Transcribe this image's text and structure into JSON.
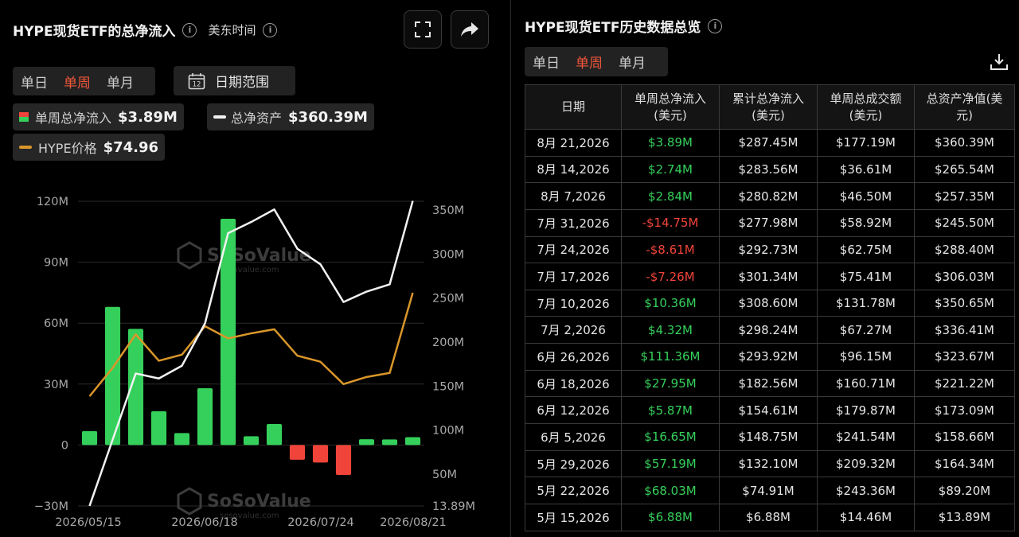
{
  "left": {
    "title": "HYPE现货ETF的总净流入",
    "timezone": "美东时间",
    "tabs": [
      {
        "label": "单日",
        "active": false
      },
      {
        "label": "单周",
        "active": true
      },
      {
        "label": "单月",
        "active": false
      }
    ],
    "date_range_label": "日期范围",
    "calendar_day": "12",
    "icons": {
      "fullscreen": "fullscreen-icon",
      "share": "share-icon",
      "info": "info-icon",
      "calendar": "calendar-icon"
    },
    "legend": [
      {
        "name": "单周总净流入",
        "value": "$3.89M"
      },
      {
        "name": "总净资产",
        "value": "$360.39M"
      },
      {
        "name": "HYPE价格",
        "value": "$74.96"
      }
    ],
    "watermark": {
      "brand": "SoSoValue",
      "site": "sosovalue.com"
    }
  },
  "right": {
    "title": "HYPE现货ETF历史数据总览",
    "tabs": [
      {
        "label": "单日",
        "active": false
      },
      {
        "label": "单周",
        "active": true
      },
      {
        "label": "单月",
        "active": false
      }
    ],
    "export_icon": "download-icon",
    "table": {
      "headers": [
        [
          "日期"
        ],
        [
          "单周总净流入",
          "(美元)"
        ],
        [
          "累计总净流入",
          "(美元)"
        ],
        [
          "单周总成交额",
          "(美元)"
        ],
        [
          "总资产净值(美",
          "元)"
        ]
      ],
      "rows": [
        [
          "8月 21,2026",
          "$3.89M",
          "$287.45M",
          "$177.19M",
          "$360.39M"
        ],
        [
          "8月 14,2026",
          "$2.74M",
          "$283.56M",
          "$36.61M",
          "$265.54M"
        ],
        [
          "8月 7,2026",
          "$2.84M",
          "$280.82M",
          "$46.50M",
          "$257.35M"
        ],
        [
          "7月 31,2026",
          "-$14.75M",
          "$277.98M",
          "$58.92M",
          "$245.50M"
        ],
        [
          "7月 24,2026",
          "-$8.61M",
          "$292.73M",
          "$62.75M",
          "$288.40M"
        ],
        [
          "7月 17,2026",
          "-$7.26M",
          "$301.34M",
          "$75.41M",
          "$306.03M"
        ],
        [
          "7月 10,2026",
          "$10.36M",
          "$308.60M",
          "$131.78M",
          "$350.65M"
        ],
        [
          "7月 2,2026",
          "$4.32M",
          "$298.24M",
          "$67.27M",
          "$336.41M"
        ],
        [
          "6月 26,2026",
          "$111.36M",
          "$293.92M",
          "$96.15M",
          "$323.67M"
        ],
        [
          "6月 18,2026",
          "$27.95M",
          "$182.56M",
          "$160.71M",
          "$221.22M"
        ],
        [
          "6月 12,2026",
          "$5.87M",
          "$154.61M",
          "$179.87M",
          "$173.09M"
        ],
        [
          "6月 5,2026",
          "$16.65M",
          "$148.75M",
          "$241.54M",
          "$158.66M"
        ],
        [
          "5月 29,2026",
          "$57.19M",
          "$132.10M",
          "$209.32M",
          "$164.34M"
        ],
        [
          "5月 22,2026",
          "$68.03M",
          "$74.91M",
          "$243.36M",
          "$89.20M"
        ],
        [
          "5月 15,2026",
          "$6.88M",
          "$6.88M",
          "$14.46M",
          "$13.89M"
        ]
      ]
    }
  },
  "colors": {
    "positive": "#35d05b",
    "negative": "#f0443a",
    "active_tab": "#f0553b",
    "net_assets_line": "#f2f2f2",
    "price_line": "#d9962a",
    "background": "#000000"
  },
  "chart_data": {
    "type": "bar",
    "categories": [
      "2026/05/15",
      "2026/05/22",
      "2026/05/29",
      "2026/06/05",
      "2026/06/12",
      "2026/06/18",
      "2026/06/26",
      "2026/07/02",
      "2026/07/10",
      "2026/07/17",
      "2026/07/24",
      "2026/07/31",
      "2026/08/07",
      "2026/08/14",
      "2026/08/21"
    ],
    "x_tick_labels": [
      "2026/05/15",
      "2026/06/18",
      "2026/07/24",
      "2026/08/21"
    ],
    "series": [
      {
        "name": "单周总净流入",
        "type": "bar",
        "axis": "left",
        "values": [
          6.88,
          68.03,
          57.19,
          16.65,
          5.87,
          27.95,
          111.36,
          4.32,
          10.36,
          -7.26,
          -8.61,
          -14.75,
          2.84,
          2.74,
          3.89
        ]
      },
      {
        "name": "总净资产",
        "type": "line",
        "axis": "right",
        "values": [
          13.89,
          89.2,
          164.34,
          158.66,
          173.09,
          221.22,
          323.67,
          336.41,
          350.65,
          306.03,
          288.4,
          245.5,
          257.35,
          265.54,
          360.39
        ]
      },
      {
        "name": "HYPE价格",
        "type": "line",
        "axis": "hidden",
        "values": [
          24,
          38,
          54.5,
          41.5,
          44.5,
          58.5,
          52.5,
          55,
          57,
          44,
          41,
          30,
          33.5,
          35.5,
          74.96
        ]
      }
    ],
    "y_left": {
      "ticks": [
        120,
        90,
        60,
        30,
        0,
        -30
      ],
      "tick_labels": [
        "120M",
        "90M",
        "60M",
        "30M",
        "0",
        "−30M"
      ],
      "ylim": [
        -30,
        120
      ]
    },
    "y_right": {
      "ticks": [
        350,
        300,
        250,
        200,
        150,
        100,
        50
      ],
      "tick_labels": [
        "350M",
        "300M",
        "250M",
        "200M",
        "150M",
        "100M",
        "50M",
        "13.89M"
      ],
      "ylim": [
        13.89,
        360.39
      ]
    },
    "grid": "horizontal",
    "legend": "top-left"
  }
}
